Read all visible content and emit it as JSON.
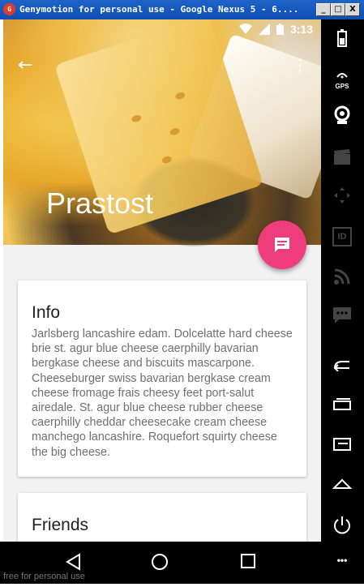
{
  "window": {
    "app_icon": "G",
    "title": "Genymotion for personal use - Google Nexus 5 - 6....",
    "minimize": "_",
    "maximize": "□",
    "close": "X"
  },
  "statusbar": {
    "time": "3:13"
  },
  "toolbar": {
    "back_icon": "←",
    "overflow_icon": "⋮"
  },
  "hero": {
    "title": "Prastost"
  },
  "fab": {
    "icon": "message-icon",
    "color": "#ef3d7c"
  },
  "cards": {
    "info": {
      "title": "Info",
      "body": "Jarlsberg lancashire edam. Dolcelatte hard cheese brie st. agur blue cheese caerphilly bavarian bergkase cheese and biscuits mascarpone. Cheeseburger swiss bavarian bergkase cream cheese fromage frais cheesy feet port-salut airedale. St. agur blue cheese rubber cheese caerphilly cheddar cheesecake cream cheese manchego lancashire. Roquefort squirty cheese the big cheese."
    },
    "friends": {
      "title": "Friends"
    }
  },
  "navbar": {
    "back": "◁",
    "home": "○",
    "recents": "□"
  },
  "sidebar": {
    "items": [
      {
        "name": "battery-icon",
        "label": ""
      },
      {
        "name": "gps-icon",
        "label": "GPS"
      },
      {
        "name": "webcam-icon",
        "label": ""
      },
      {
        "name": "clapboard-icon",
        "label": ""
      },
      {
        "name": "dpad-icon",
        "label": ""
      },
      {
        "name": "id-icon",
        "label": "ID"
      },
      {
        "name": "rss-icon",
        "label": ""
      },
      {
        "name": "sms-icon",
        "label": ""
      },
      {
        "name": "back-icon",
        "label": ""
      },
      {
        "name": "recent-apps-icon",
        "label": ""
      },
      {
        "name": "menu-icon",
        "label": ""
      },
      {
        "name": "home-icon",
        "label": ""
      },
      {
        "name": "power-icon",
        "label": ""
      },
      {
        "name": "more-icon",
        "label": "•••"
      }
    ]
  },
  "watermark": "free for personal use"
}
